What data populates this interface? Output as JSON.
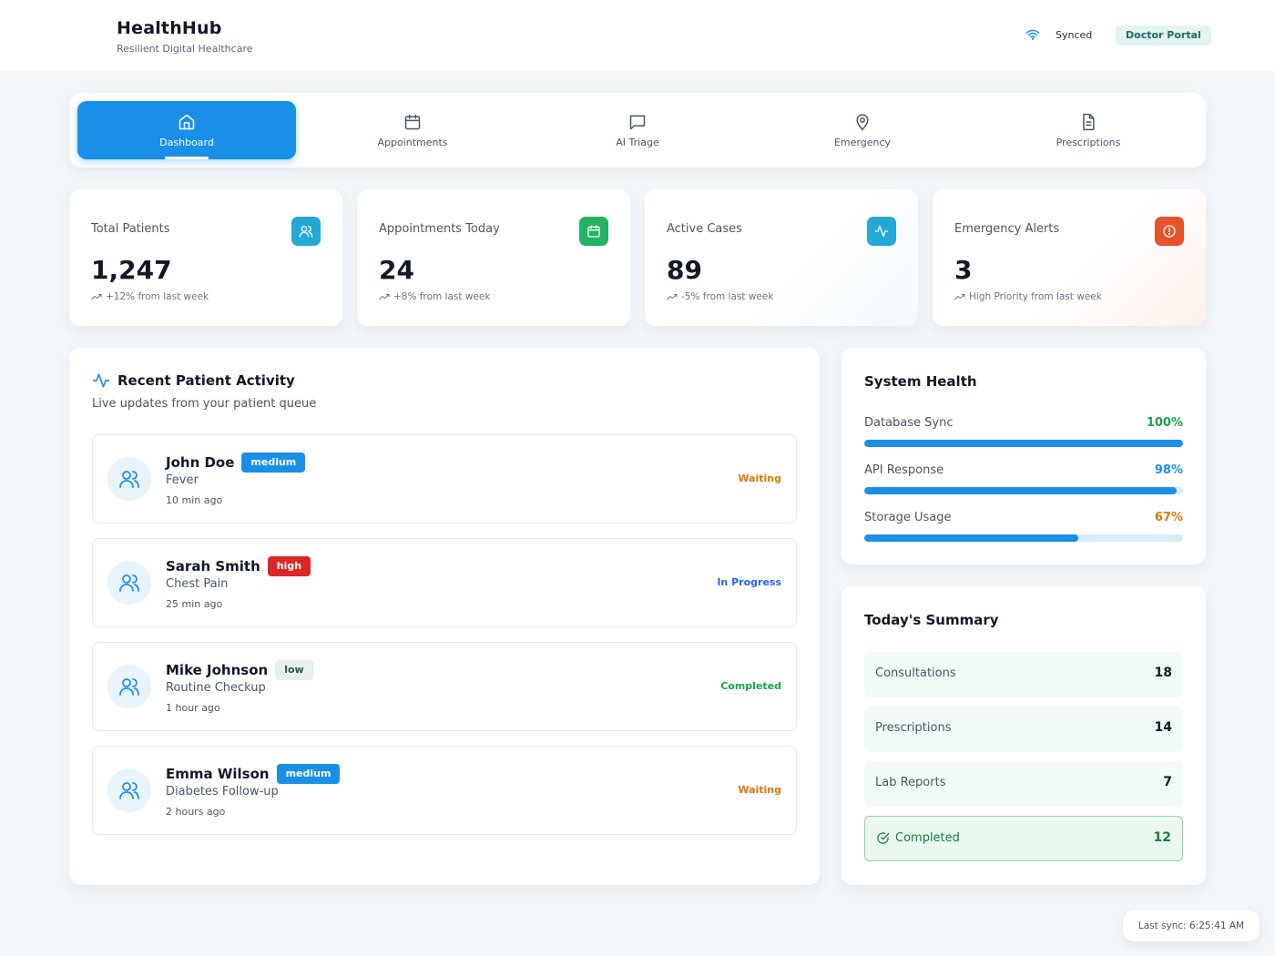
{
  "header": {
    "title": "HealthHub",
    "subtitle": "Resilient Digital Healthcare",
    "sync_status": "Synced",
    "portal_badge": "Doctor Portal"
  },
  "nav": {
    "tabs": [
      {
        "label": "Dashboard",
        "icon": "home-icon",
        "active": true
      },
      {
        "label": "Appointments",
        "icon": "calendar-icon"
      },
      {
        "label": "AI Triage",
        "icon": "message-square-icon"
      },
      {
        "label": "Emergency",
        "icon": "map-pin-icon"
      },
      {
        "label": "Prescriptions",
        "icon": "file-text-icon"
      }
    ]
  },
  "stats": [
    {
      "title": "Total Patients",
      "value": "1,247",
      "trend": "+12% from last week",
      "icon": "users-icon",
      "color": "#22a9d6"
    },
    {
      "title": "Appointments Today",
      "value": "24",
      "trend": "+8% from last week",
      "icon": "calendar-icon",
      "color": "#22b463"
    },
    {
      "title": "Active Cases",
      "value": "89",
      "trend": "-5% from last week",
      "icon": "activity-icon",
      "color": "#22a9d6"
    },
    {
      "title": "Emergency Alerts",
      "value": "3",
      "trend": "High Priority from last week",
      "icon": "alert-circle-icon",
      "color": "#e5542a"
    }
  ],
  "activity": {
    "title": "Recent Patient Activity",
    "subtitle": "Live updates from your patient queue",
    "patients": [
      {
        "name": "John Doe",
        "priority": "medium",
        "condition": "Fever",
        "time": "10 min ago",
        "status": "Waiting"
      },
      {
        "name": "Sarah Smith",
        "priority": "high",
        "condition": "Chest Pain",
        "time": "25 min ago",
        "status": "In Progress"
      },
      {
        "name": "Mike Johnson",
        "priority": "low",
        "condition": "Routine Checkup",
        "time": "1 hour ago",
        "status": "Completed"
      },
      {
        "name": "Emma Wilson",
        "priority": "medium",
        "condition": "Diabetes Follow-up",
        "time": "2 hours ago",
        "status": "Waiting"
      }
    ]
  },
  "health": {
    "title": "System Health",
    "metrics": [
      {
        "label": "Database Sync",
        "value": "100%",
        "percent": 100,
        "color": "#16a34a"
      },
      {
        "label": "API Response",
        "value": "98%",
        "percent": 98,
        "color": "#1a8fe8"
      },
      {
        "label": "Storage Usage",
        "value": "67%",
        "percent": 67,
        "color": "#d97706"
      }
    ]
  },
  "summary": {
    "title": "Today's Summary",
    "rows": [
      {
        "label": "Consultations",
        "value": "18"
      },
      {
        "label": "Prescriptions",
        "value": "14"
      },
      {
        "label": "Lab Reports",
        "value": "7"
      },
      {
        "label": "Completed",
        "value": "12"
      }
    ]
  },
  "footer": {
    "last_sync": "Last sync: 6:25:41 AM"
  }
}
